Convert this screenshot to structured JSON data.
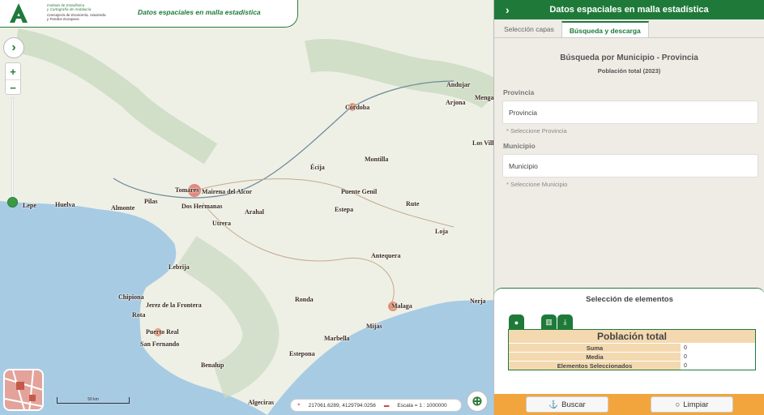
{
  "header": {
    "institute_line1": "Instituto de Estadística",
    "institute_line2": "y Cartografía de Andalucía",
    "dept_line1": "Consejería de Economía, Hacienda",
    "dept_line2": "y Fondos Europeos",
    "app_title": "Datos espaciales en malla estadística"
  },
  "map": {
    "cities": [
      "Andujar",
      "Arjona",
      "Menga",
      "Córdoba",
      "Los Vill",
      "Écija",
      "Montilla",
      "Tomares",
      "Mairena del Alcor",
      "Lepe",
      "Huelva",
      "Almonte",
      "Pilas",
      "Dos Hermanas",
      "Puente Genil",
      "Rute",
      "Utrera",
      "Arahal",
      "Estepa",
      "Loja",
      "Antequera",
      "Lebrija",
      "Chipiona",
      "Jerez de la Frontera",
      "Rota",
      "Ronda",
      "Malaga",
      "Nerja",
      "Puerto Real",
      "San Fernando",
      "Mijas",
      "Marbella",
      "Benalup",
      "Estepona",
      "Algeciras"
    ],
    "scale_label": "50 km",
    "coords": "217061.6289, 4129794.0256",
    "scale_text": "Escala = 1 : 1000000"
  },
  "panel": {
    "title": "Datos espaciales en malla estadística",
    "tabs": [
      "Selección capas",
      "Búsqueda y descarga"
    ],
    "search_title": "Búsqueda por Municipio - Provincia",
    "search_subtitle": "Población total (2023)",
    "provincia_label": "Provincia",
    "provincia_value": "Provincia",
    "provincia_hint": "* Seleccione Provincia",
    "municipio_label": "Municipio",
    "municipio_value": "Municipio",
    "municipio_hint": "* Seleccione Municipio",
    "selection_title": "Selección de elementos",
    "table_title": "Población total",
    "rows": [
      {
        "label": "Suma",
        "value": "0"
      },
      {
        "label": "Media",
        "value": "0"
      },
      {
        "label": "Elementos Seleccionados",
        "value": "0"
      }
    ],
    "buscar_label": "Buscar",
    "limpiar_label": "Limpiar"
  },
  "colors": {
    "accent": "#1f7a3a",
    "footer": "#f2a53c",
    "sea": "#a8cbe4"
  }
}
